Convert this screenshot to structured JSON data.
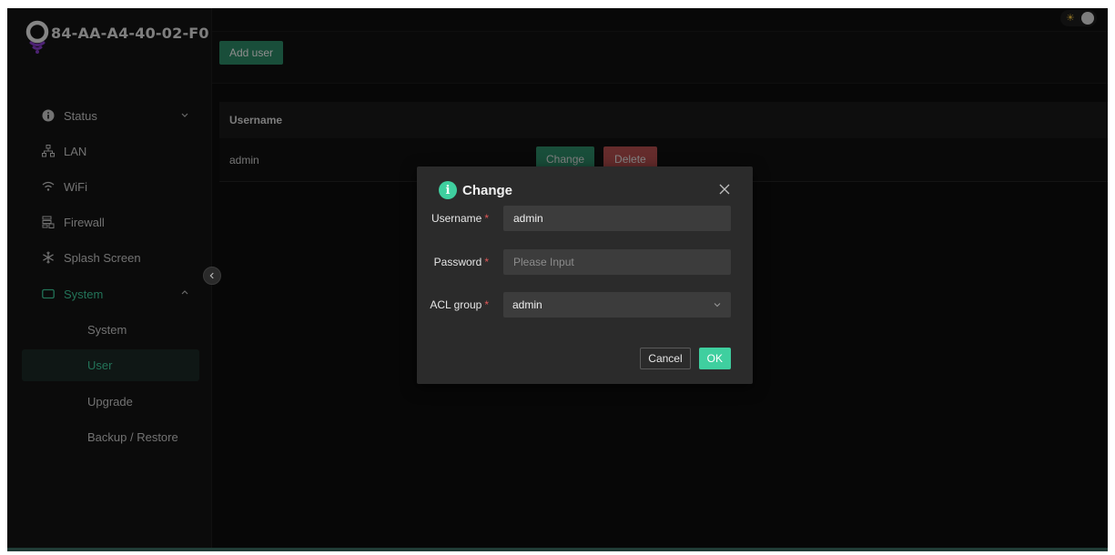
{
  "header": {
    "device_name": "84-AA-A4-40-02-F0"
  },
  "theme": {
    "sun_glyph": "☀",
    "accent": "#3fcf9f"
  },
  "sidebar": {
    "items": [
      {
        "label": "Status",
        "icon": "info-icon"
      },
      {
        "label": "LAN",
        "icon": "network-icon"
      },
      {
        "label": "WiFi",
        "icon": "wifi-icon"
      },
      {
        "label": "Firewall",
        "icon": "firewall-icon"
      },
      {
        "label": "Splash Screen",
        "icon": "snowflake-icon"
      },
      {
        "label": "System",
        "icon": "monitor-icon"
      }
    ],
    "sub_items": [
      {
        "label": "System"
      },
      {
        "label": "User"
      },
      {
        "label": "Upgrade"
      },
      {
        "label": "Backup / Restore"
      }
    ]
  },
  "toolbar": {
    "add_user_label": "Add user"
  },
  "table": {
    "columns": [
      "Username"
    ],
    "rows": [
      {
        "username": "admin",
        "change_label": "Change",
        "delete_label": "Delete"
      }
    ]
  },
  "modal": {
    "title": "Change",
    "info_glyph": "i",
    "required_mark": "*",
    "fields": {
      "username": {
        "label": "Username",
        "value": "admin"
      },
      "password": {
        "label": "Password",
        "placeholder": "Please Input"
      },
      "acl_group": {
        "label": "ACL group",
        "value": "admin"
      }
    },
    "cancel_label": "Cancel",
    "ok_label": "OK"
  }
}
